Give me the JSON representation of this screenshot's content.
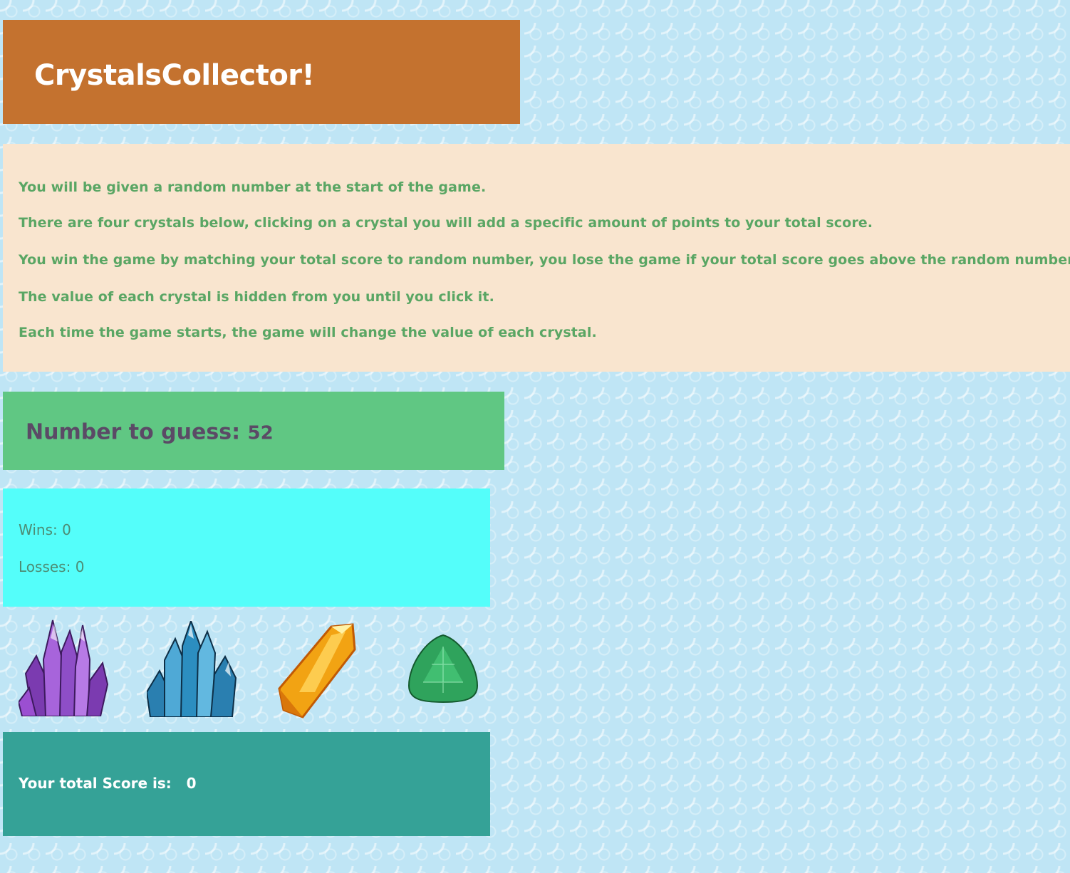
{
  "header": {
    "title": "CrystalsCollector!"
  },
  "instructions": [
    "You will be given a random number at the start of the game.",
    "There are four crystals below, clicking on a crystal you will add a specific amount of points to your total score.",
    "You win the game by matching your total score to random number, you lose the game if your total score goes above the random number.",
    "The value of each crystal is hidden from you until you click it.",
    "Each time the game starts, the game will change the value of each crystal."
  ],
  "target": {
    "label": "Number to guess:",
    "value": "52"
  },
  "stats": {
    "wins_label": "Wins:",
    "wins": "0",
    "losses_label": "Losses:",
    "losses": "0"
  },
  "crystals": [
    {
      "name": "purple-crystal",
      "color": "#9b4fd1"
    },
    {
      "name": "blue-crystal",
      "color": "#2c8ec0"
    },
    {
      "name": "amber-crystal",
      "color": "#f2a313"
    },
    {
      "name": "green-crystal",
      "color": "#2fa35c"
    }
  ],
  "score": {
    "label": "Your total Score is:",
    "value": "0"
  },
  "colors": {
    "background": "#bfe5f5",
    "title_bg": "#c4722f",
    "instructions_bg": "#f9e5cf",
    "instructions_text": "#5aa664",
    "target_bg": "#60c783",
    "stats_bg": "#54fefa",
    "score_bg": "#35a297"
  }
}
